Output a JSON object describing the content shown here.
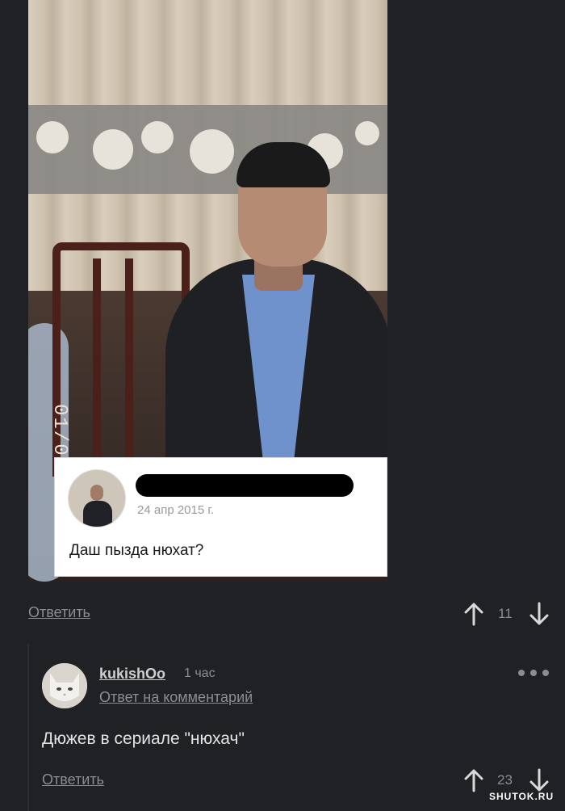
{
  "post": {
    "photo_timestamp_overlay": "01/0",
    "embedded_card": {
      "date": "24 апр 2015 г.",
      "message": "Даш пызда нюхат?"
    },
    "reply_label": "Ответить",
    "vote_count": "11"
  },
  "reply_comment": {
    "username": "kukishOo",
    "time": "1 час",
    "reply_to_label": "Ответ на комментарий",
    "text": "Дюжев в сериале \"нюхач\"",
    "reply_label": "Ответить",
    "vote_count": "23"
  },
  "watermark": "SHUTOK.RU",
  "icons": {
    "upvote": "arrow-up-icon",
    "downvote": "arrow-down-icon",
    "more": "more-dots-icon"
  },
  "colors": {
    "background": "#1f2124",
    "muted_text": "#8a8d91",
    "text": "#e3e3e3"
  }
}
